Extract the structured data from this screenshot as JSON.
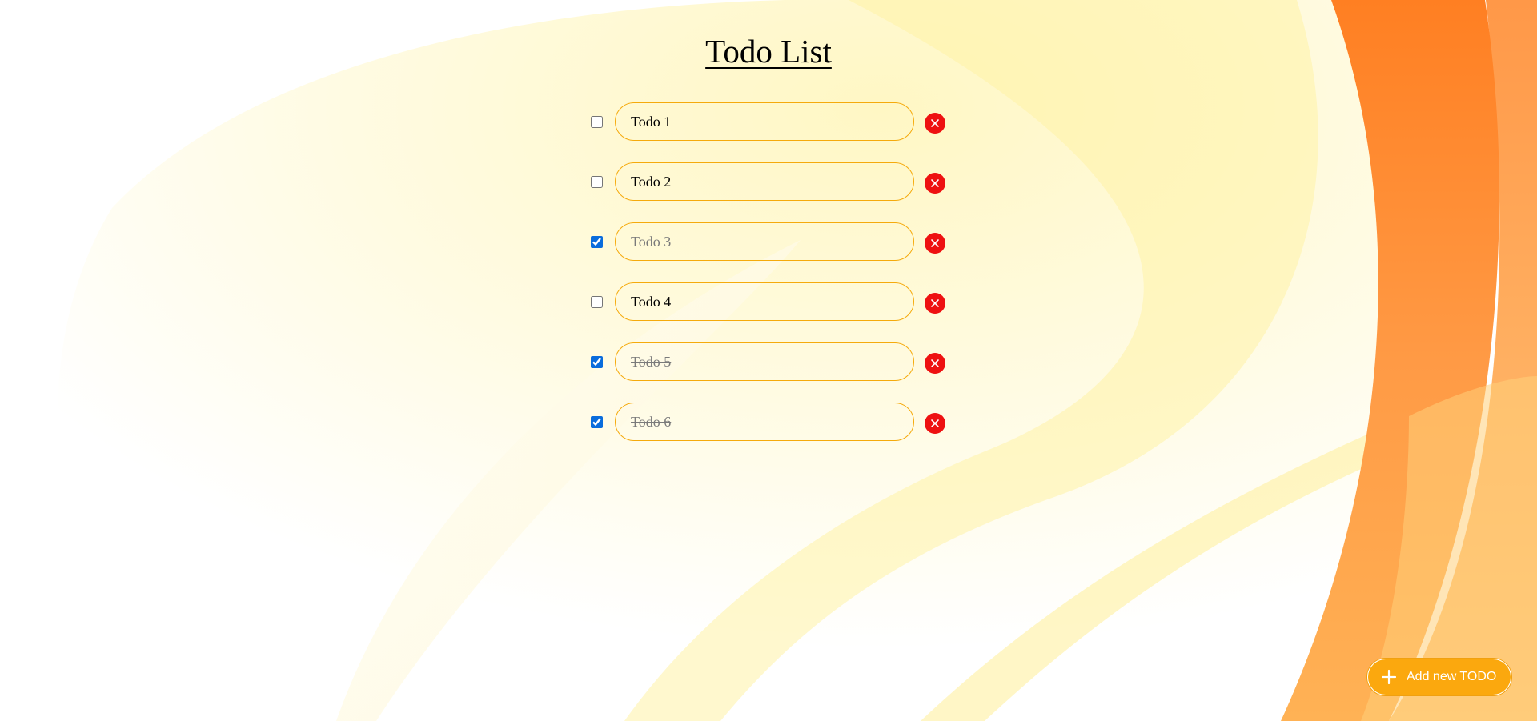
{
  "page": {
    "title": "Todo List"
  },
  "todos": [
    {
      "text": "Todo 1",
      "done": false
    },
    {
      "text": "Todo 2",
      "done": false
    },
    {
      "text": "Todo 3",
      "done": true
    },
    {
      "text": "Todo 4",
      "done": false
    },
    {
      "text": "Todo 5",
      "done": true
    },
    {
      "text": "Todo 6",
      "done": true
    }
  ],
  "delete_icon": "close-icon",
  "add_button": {
    "label": "Add new TODO",
    "icon": "plus-icon"
  },
  "colors": {
    "field_border": "#f5aa0c",
    "delete": "#ee1111",
    "add_button": "#fba80e",
    "checkbox": "#0a6cdc",
    "background_orange": "#ff7f24",
    "background_yellow": "#fff3b0"
  }
}
